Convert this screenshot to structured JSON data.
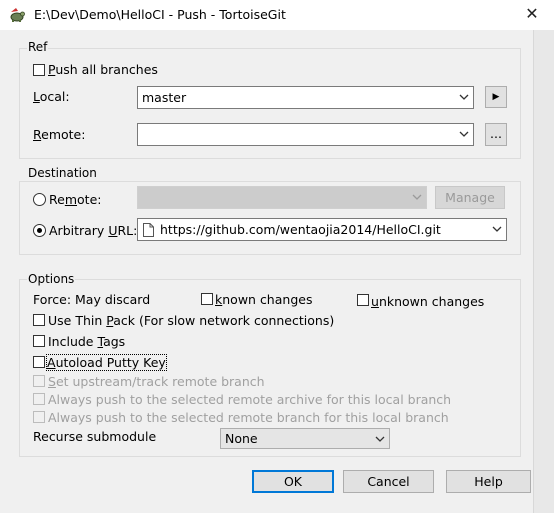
{
  "window": {
    "title": "E:\\Dev\\Demo\\HelloCI - Push - TortoiseGit",
    "close_glyph": "✕"
  },
  "ref": {
    "group_label": "Ref",
    "push_all_branches": {
      "label": "Push all branches",
      "checked": false
    },
    "local": {
      "label": "Local:",
      "value": "master"
    },
    "local_browse_glyph": "▶",
    "remote": {
      "label": "Remote:",
      "value": ""
    },
    "remote_browse_label": "..."
  },
  "destination": {
    "group_label": "Destination",
    "remote_radio": {
      "label": "Remote:",
      "selected": false
    },
    "remote_value": "",
    "manage_label": "Manage",
    "arbitrary_url_radio": {
      "label": "Arbitrary URL:",
      "selected": true
    },
    "url_value": "https://github.com/wentaojia2014/HelloCI.git"
  },
  "options": {
    "group_label": "Options",
    "force_label": "Force: May discard",
    "known_changes": {
      "label": "known changes",
      "checked": false
    },
    "unknown_changes": {
      "label": "unknown changes",
      "checked": false
    },
    "use_thin_pack": {
      "label": "Use Thin Pack (For slow network connections)",
      "checked": false
    },
    "include_tags": {
      "label": "Include Tags",
      "checked": false
    },
    "autoload_putty_key": {
      "label": "Autoload Putty Key",
      "checked": false
    },
    "set_upstream": {
      "label": "Set upstream/track remote branch",
      "checked": false,
      "enabled": false
    },
    "always_push_archive": {
      "label": "Always push to the selected remote archive for this local branch",
      "checked": false,
      "enabled": false
    },
    "always_push_branch": {
      "label": "Always push to the selected remote branch for this local branch",
      "checked": false,
      "enabled": false
    },
    "recurse_label": "Recurse submodule",
    "recurse_value": "None"
  },
  "buttons": {
    "ok": "OK",
    "cancel": "Cancel",
    "help": "Help"
  },
  "colors": {
    "accent": "#0078d7",
    "dialog_bg": "#f0f0f0",
    "disabled_text": "#a0a0a0"
  }
}
